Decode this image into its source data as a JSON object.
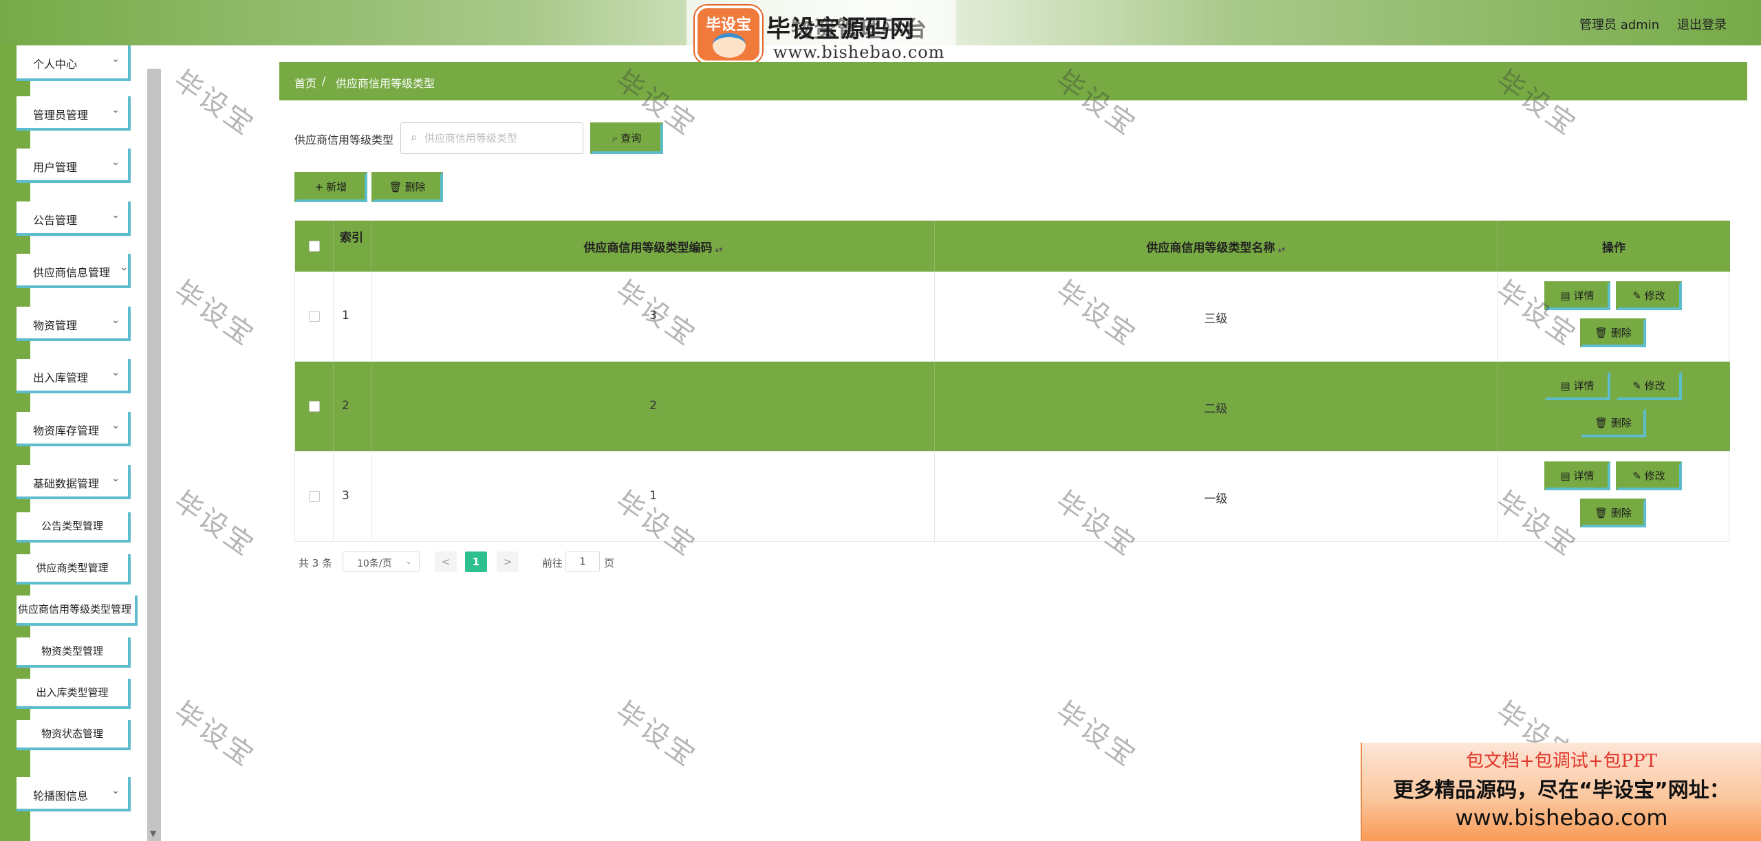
{
  "header": {
    "logo_badge": "毕设宝",
    "title": "毕设宝源码网",
    "title_overlay": "物资管理平台",
    "url": "www.bishebao.com",
    "user": "管理员 admin",
    "logout": "退出登录"
  },
  "sidebar": {
    "items": [
      {
        "label": "个人中心"
      },
      {
        "label": "管理员管理"
      },
      {
        "label": "用户管理"
      },
      {
        "label": "公告管理"
      },
      {
        "label": "供应商信息管理"
      },
      {
        "label": "物资管理"
      },
      {
        "label": "出入库管理"
      },
      {
        "label": "物资库存管理"
      },
      {
        "label": "基础数据管理"
      }
    ],
    "subitems": [
      {
        "label": "公告类型管理"
      },
      {
        "label": "供应商类型管理"
      },
      {
        "label": "供应商信用等级类型管理"
      },
      {
        "label": "物资类型管理"
      },
      {
        "label": "出入库类型管理"
      },
      {
        "label": "物资状态管理"
      }
    ],
    "last_item": {
      "label": "轮播图信息"
    }
  },
  "breadcrumb": {
    "home": "首页",
    "separator": "/",
    "current": "供应商信用等级类型"
  },
  "search": {
    "label": "供应商信用等级类型",
    "placeholder": "供应商信用等级类型",
    "value": "",
    "button": "查询"
  },
  "toolbar": {
    "add": "新增",
    "delete": "删除"
  },
  "table": {
    "headers": {
      "index": "索引",
      "code": "供应商信用等级类型编码",
      "name": "供应商信用等级类型名称",
      "ops": "操作"
    },
    "rows": [
      {
        "index": "1",
        "code": "3",
        "name": "三级"
      },
      {
        "index": "2",
        "code": "2",
        "name": "二级"
      },
      {
        "index": "3",
        "code": "1",
        "name": "一级"
      }
    ],
    "actions": {
      "detail": "详情",
      "edit": "修改",
      "delete": "删除"
    }
  },
  "pagination": {
    "total": "共 3 条",
    "page_size": "10条/页",
    "prev": "<",
    "current": "1",
    "next": ">",
    "goto": "前往",
    "goto_value": "1",
    "page_suffix": "页"
  },
  "watermark": "毕设宝",
  "promo": {
    "line1": "包文档+包调试+包PPT",
    "line2": "更多精品源码，尽在“毕设宝”网址：",
    "line3": "www.bishebao.com"
  },
  "colors": {
    "accent_green": "#77aa43",
    "border_cyan": "#5ebdcc",
    "page_active": "#2fbf8f"
  }
}
